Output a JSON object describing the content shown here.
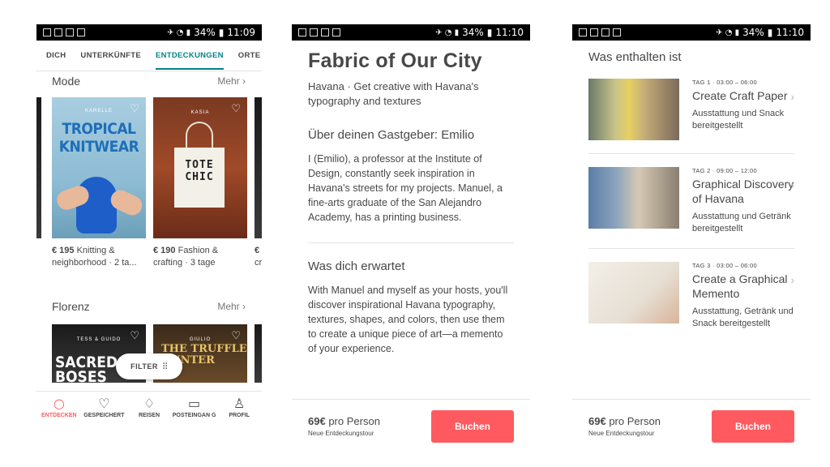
{
  "status": {
    "battery": "34%",
    "time1": "11:09",
    "time2": "11:10",
    "time3": "11:10"
  },
  "screen1": {
    "tabs": [
      "DICH",
      "UNTERKÜNFTE",
      "ENTDECKUNGEN",
      "ORTE"
    ],
    "sections": [
      {
        "title": "Mode",
        "more": "Mehr ›"
      },
      {
        "title": "Florenz",
        "more": "Mehr ›"
      }
    ],
    "cards": [
      {
        "brand": "KARELLE",
        "art_text": "TROPICAL KNITWEAR",
        "price": "€ 195",
        "desc_line1": "Knitting &",
        "desc_line2": "neighborhood · 2 ta..."
      },
      {
        "brand": "KASIA",
        "art_text": "TOTE CHIC",
        "price": "€ 190",
        "desc_line1": "Fashion &",
        "desc_line2": "crafting · 3 tage"
      },
      {
        "price": "€",
        "desc_line2": "cr"
      }
    ],
    "cards2": [
      {
        "brand": "TESS & GUIDO",
        "art_text": "SACRED BOSES"
      },
      {
        "brand": "GIULIO",
        "art_text": "THE TRUFFLE HUNTER"
      }
    ],
    "filter_label": "FILTER",
    "bottom_nav": [
      "ENTDECKEN",
      "GESPEICHERT",
      "REISEN",
      "POSTEINGAN G",
      "PROFIL"
    ]
  },
  "screen2": {
    "title": "Fabric of Our City",
    "subtitle": "Havana · Get creative with Havana's typography and textures",
    "host_heading": "Über deinen Gastgeber: Emilio",
    "host_text": "I (Emilio), a professor at the Institute of Design, constantly seek inspiration in Havana's streets for my projects. Manuel, a fine-arts graduate of the San Alejandro Academy, has a printing business.",
    "expect_heading": "Was dich erwartet",
    "expect_text": "With Manuel and myself as your hosts, you'll discover inspirational Havana typography, textures, shapes, and colors, then use them to create a unique piece of art—a memento of your experience.",
    "price": "69€",
    "per": "pro Person",
    "tour_label": "Neue Entdeckungstour",
    "book_label": "Buchen"
  },
  "screen3": {
    "title": "Was enthalten ist",
    "days": [
      {
        "meta": "TAG 1 · 03:00 – 06:00",
        "name": "Create Craft Paper",
        "note": "Ausstattung und Snack bereitgestellt"
      },
      {
        "meta": "TAG 2 · 09:00 – 12:00",
        "name": "Graphical Discovery of Havana",
        "note": "Ausstattung und Getränk bereitgestellt"
      },
      {
        "meta": "TAG 3 · 03:00 – 06:00",
        "name": "Create a Graphical Memento",
        "note": "Ausstattung, Getränk und Snack bereitgestellt"
      }
    ],
    "price": "69€",
    "per": "pro Person",
    "tour_label": "Neue Entdeckungstour",
    "book_label": "Buchen"
  },
  "colors": {
    "accent_teal": "#008489",
    "brand_red": "#ff5a5f",
    "text": "#484848"
  },
  "icons": [
    "search-icon",
    "heart-icon",
    "airbnb-icon",
    "message-icon",
    "profile-icon",
    "filter-icon",
    "chevron-right-icon"
  ]
}
